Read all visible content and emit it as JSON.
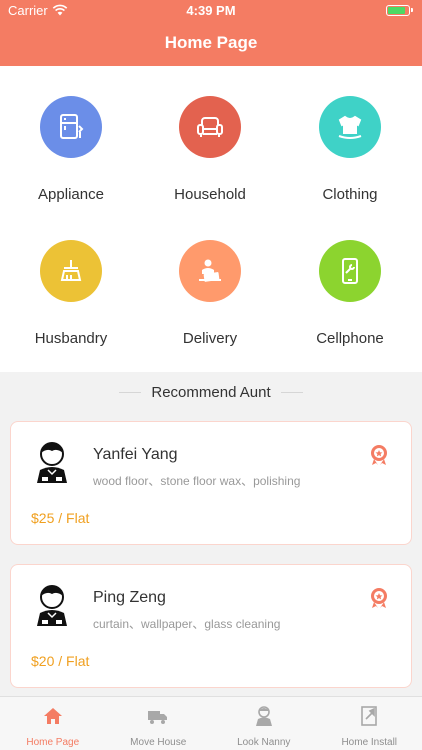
{
  "status_bar": {
    "carrier": "Carrier",
    "time": "4:39 PM"
  },
  "header": {
    "title": "Home Page",
    "color": "#f47c63"
  },
  "categories": [
    {
      "label": "Appliance",
      "color": "#6b8ee8",
      "icon": "appliance-icon"
    },
    {
      "label": "Household",
      "color": "#e3624f",
      "icon": "sofa-icon"
    },
    {
      "label": "Clothing",
      "color": "#3fd2c7",
      "icon": "shirt-icon"
    },
    {
      "label": "Husbandry",
      "color": "#ecc236",
      "icon": "broom-icon"
    },
    {
      "label": "Delivery",
      "color": "#ff9a6c",
      "icon": "delivery-icon"
    },
    {
      "label": "Cellphone",
      "color": "#8cd42f",
      "icon": "phone-repair-icon"
    }
  ],
  "recommend": {
    "title": "Recommend Aunt",
    "aunts": [
      {
        "name": "Yanfei Yang",
        "skills": "wood floor、stone floor wax、polishing",
        "price": "$25 / Flat"
      },
      {
        "name": "Ping Zeng",
        "skills": "curtain、wallpaper、glass cleaning",
        "price": "$20 / Flat"
      }
    ]
  },
  "tabbar": {
    "tabs": [
      {
        "label": "Home Page",
        "icon": "home-icon",
        "active": true
      },
      {
        "label": "Move House",
        "icon": "truck-icon",
        "active": false
      },
      {
        "label": "Look Nanny",
        "icon": "nanny-icon",
        "active": false
      },
      {
        "label": "Home Install",
        "icon": "install-icon",
        "active": false
      }
    ]
  }
}
